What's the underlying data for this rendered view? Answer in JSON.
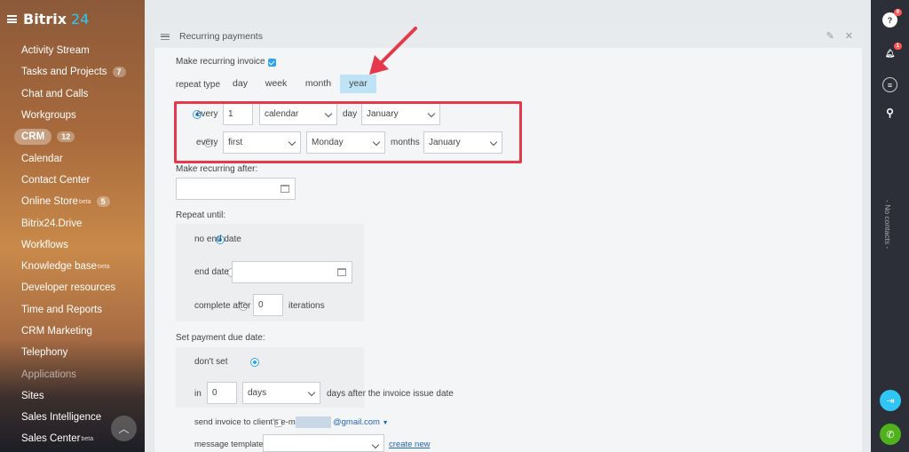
{
  "app": {
    "logo_text": "Bitrix",
    "logo_num": "24"
  },
  "sidebar": {
    "items": [
      {
        "label": "Activity Stream"
      },
      {
        "label": "Tasks and Projects",
        "count": "7"
      },
      {
        "label": "Chat and Calls"
      },
      {
        "label": "Workgroups"
      },
      {
        "label": "CRM",
        "count": "12",
        "active": true
      },
      {
        "label": "Calendar"
      },
      {
        "label": "Contact Center"
      },
      {
        "label": "Online Store",
        "sup": "beta",
        "count": "5"
      },
      {
        "label": "Bitrix24.Drive"
      },
      {
        "label": "Workflows"
      },
      {
        "label": "Knowledge base",
        "sup": "beta"
      },
      {
        "label": "Developer resources"
      },
      {
        "label": "Time and Reports"
      },
      {
        "label": "CRM Marketing"
      },
      {
        "label": "Telephony"
      },
      {
        "label": "Applications",
        "dim": true
      },
      {
        "label": "Sites"
      },
      {
        "label": "Sales Intelligence"
      },
      {
        "label": "Sales Center",
        "sup": "beta"
      }
    ]
  },
  "panel": {
    "title": "Recurring payments"
  },
  "form": {
    "make_recurring_label": "Make recurring invoice",
    "repeat_type_label": "repeat type",
    "tabs": [
      "day",
      "week",
      "month",
      "year"
    ],
    "selected_tab": "year",
    "row1": {
      "every": "every",
      "number": "1",
      "kind": "calendar",
      "day": "day",
      "month": "January"
    },
    "row2": {
      "every": "every",
      "ordinal": "first",
      "weekday": "Monday",
      "months": "months",
      "month": "January"
    },
    "make_after_label": "Make recurring after:",
    "repeat_until_label": "Repeat until:",
    "no_end_date": "no end date",
    "end_date": "end date",
    "complete_after": "complete after",
    "iterations_value": "0",
    "iterations": "iterations",
    "due_label": "Set payment due date:",
    "dont_set": "don't set",
    "in_label": "in",
    "days_value": "0",
    "days_unit": "days",
    "days_after": "days after the invoice issue date",
    "send_invoice": "send invoice to client's e-mail",
    "email_domain": "@gmail.com",
    "message_template": "message template:",
    "create_new": "create new"
  },
  "rightbar": {
    "help_badge": "9",
    "notif_badge": "1",
    "no_contacts": "- No contacts -"
  },
  "colors": {
    "accent": "#2fa3f0",
    "highlight": "#e5394b",
    "arrow": "#e5394b"
  }
}
